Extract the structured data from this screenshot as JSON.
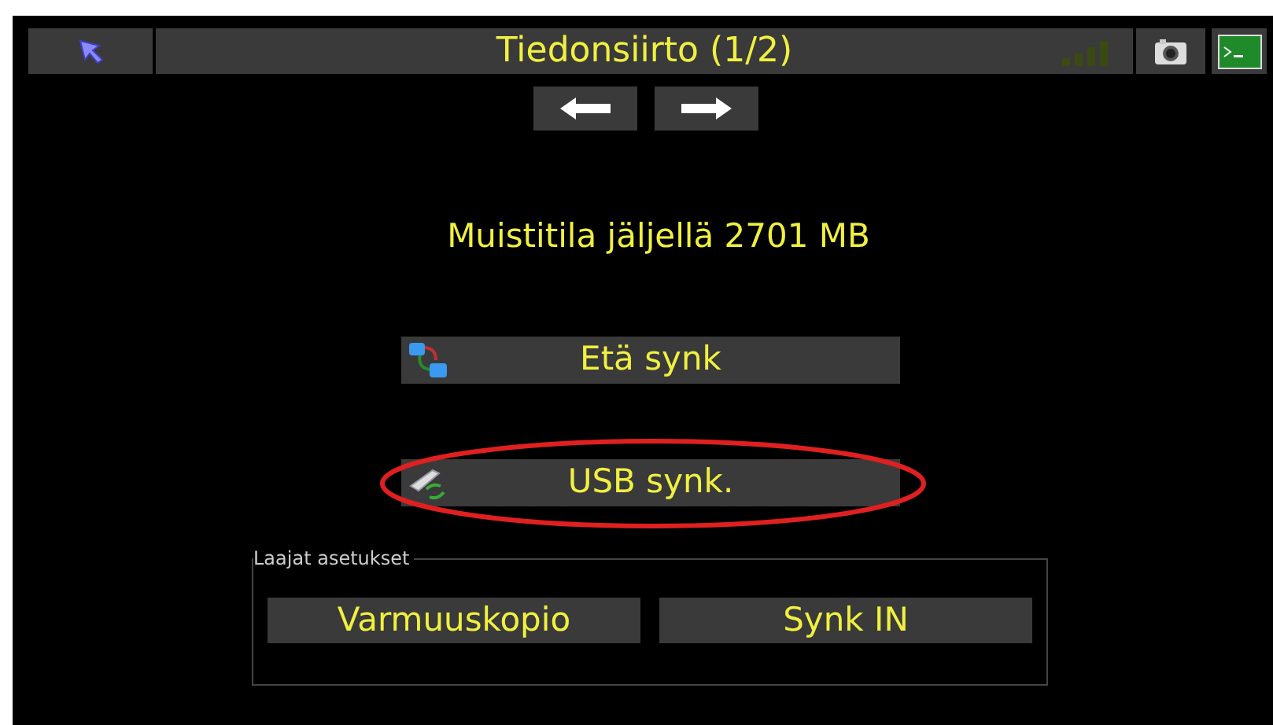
{
  "title_bar": {
    "title": "Tiedonsiirto (1/2)"
  },
  "memory_text": "Muistitila jäljellä 2701 MB",
  "actions": [
    {
      "label": "Etä synk",
      "kind": "remote",
      "highlighted": false
    },
    {
      "label": "USB synk.",
      "kind": "usb",
      "highlighted": true
    }
  ],
  "advanced_group": {
    "legend": "Laajat asetukset",
    "buttons": [
      "Varmuuskopio",
      "Synk IN"
    ]
  }
}
